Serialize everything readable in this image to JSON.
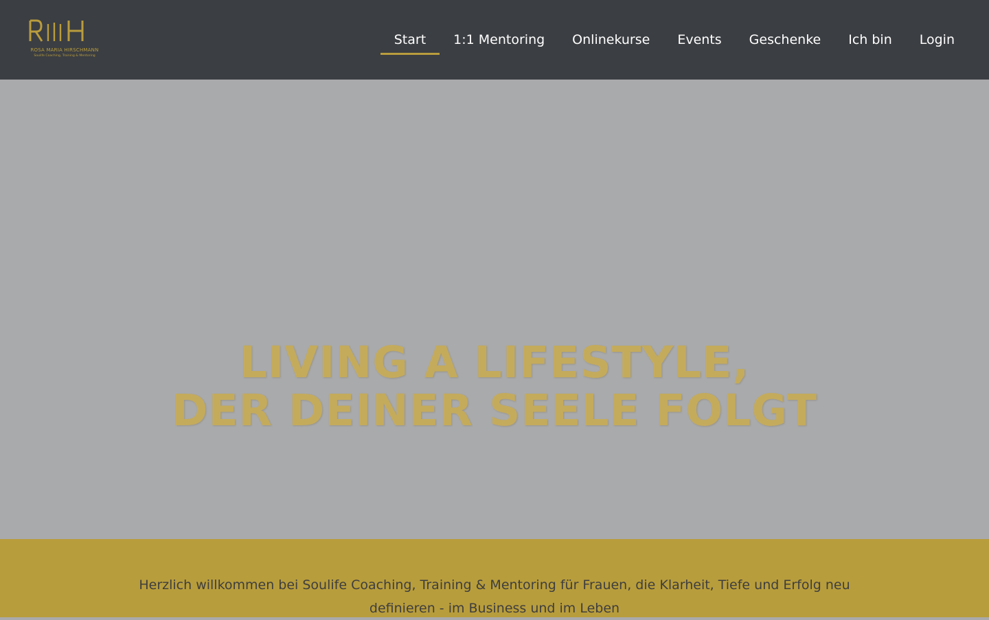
{
  "brand": {
    "logo_mark": "RMH",
    "name": "ROSA MARIA HIRSCHMANN",
    "tagline": "Soulife Coaching, Training & Mentoring",
    "color": "#b99c3d"
  },
  "nav": {
    "items": [
      {
        "label": "Start",
        "active": true
      },
      {
        "label": "1:1 Mentoring",
        "active": false
      },
      {
        "label": "Onlinekurse",
        "active": false
      },
      {
        "label": "Events",
        "active": false
      },
      {
        "label": "Geschenke",
        "active": false
      },
      {
        "label": "Ich bin",
        "active": false
      },
      {
        "label": "Login",
        "active": false
      }
    ]
  },
  "hero": {
    "line1": "LIVING A LIFESTYLE,",
    "line2": "DER DEINER SEELE FOLGT"
  },
  "intro": {
    "text": "Herzlich willkommen bei Soulife Coaching, Training & Mentoring für Frauen, die Klarheit, Tiefe und Erfolg neu definieren - im Business und im Leben"
  },
  "colors": {
    "header_bg": "#3b3e42",
    "hero_bg": "#a9aaac",
    "accent": "#b99c3d",
    "band_bg": "#b89d3c"
  }
}
